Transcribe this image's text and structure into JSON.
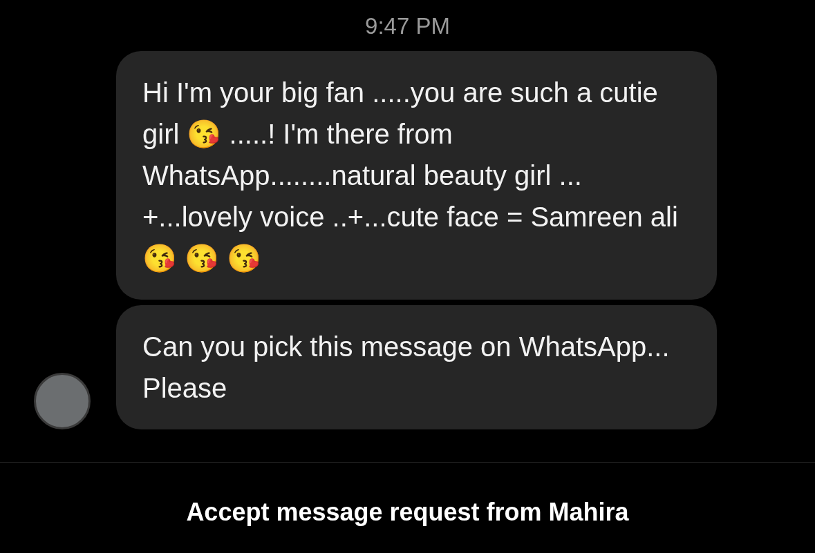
{
  "timestamp": "9:47 PM",
  "messages": [
    {
      "text": "Hi I'm your big fan .....you are such a cutie girl 😘 .....! I'm there from WhatsApp........natural beauty girl ... +...lovely voice ..+...cute face = Samreen ali 😘 😘 😘",
      "avatar": false
    },
    {
      "text": "Can you pick this message on WhatsApp... Please",
      "avatar": true
    }
  ],
  "footer": {
    "text": "Accept message request from Mahira"
  }
}
